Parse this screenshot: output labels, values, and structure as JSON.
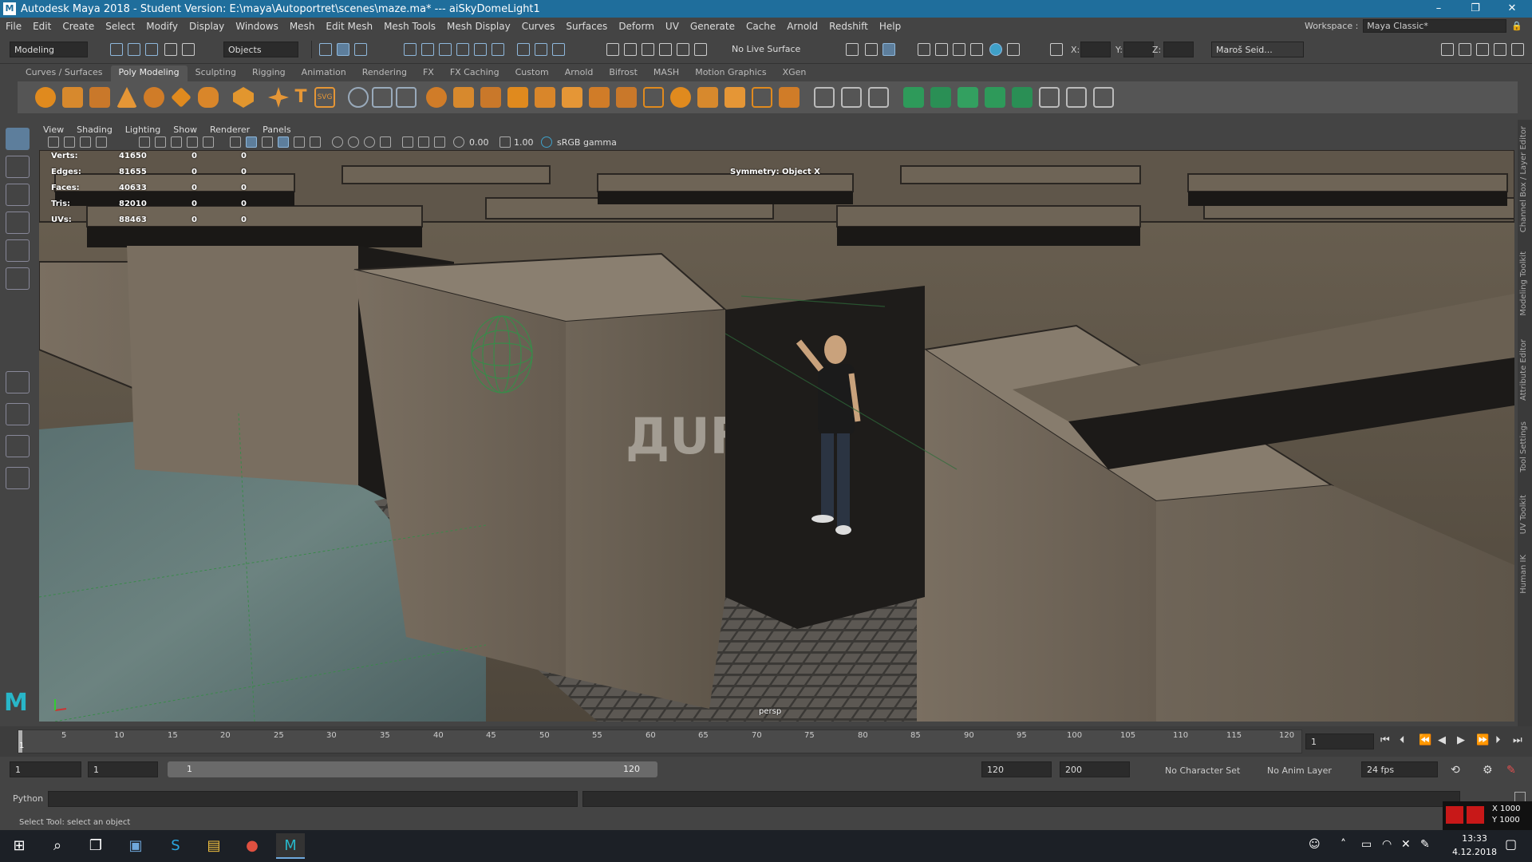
{
  "window": {
    "title": "Autodesk Maya 2018 - Student Version: E:\\maya\\Autoportret\\scenes\\maze.ma*  ---  aiSkyDomeLight1",
    "min": "–",
    "max": "❐",
    "close": "✕"
  },
  "menu": [
    "File",
    "Edit",
    "Create",
    "Select",
    "Modify",
    "Display",
    "Windows",
    "Mesh",
    "Edit Mesh",
    "Mesh Tools",
    "Mesh Display",
    "Curves",
    "Surfaces",
    "Deform",
    "UV",
    "Generate",
    "Cache",
    "Arnold",
    "Redshift",
    "Help"
  ],
  "workspace": {
    "label": "Workspace :",
    "value": "Maya Classic*"
  },
  "status": {
    "menuset": "Modeling",
    "objects": "Objects",
    "live_surface": "No Live Surface",
    "x": "X:",
    "y": "Y:",
    "z": "Z:",
    "user": "Maroš Seid..."
  },
  "shelf_tabs": [
    "Curves / Surfaces",
    "Poly Modeling",
    "Sculpting",
    "Rigging",
    "Animation",
    "Rendering",
    "FX",
    "FX Caching",
    "Custom",
    "Arnold",
    "Bifrost",
    "MASH",
    "Motion Graphics",
    "XGen"
  ],
  "active_shelf_tab": "Poly Modeling",
  "panel_menu": [
    "View",
    "Shading",
    "Lighting",
    "Show",
    "Renderer",
    "Panels"
  ],
  "panel_toolbar": {
    "exposure": "0.00",
    "gamma": "1.00",
    "colorspace": "sRGB gamma"
  },
  "hud": {
    "rows": [
      {
        "label": "Verts:",
        "a": "41650",
        "b": "0",
        "c": "0"
      },
      {
        "label": "Edges:",
        "a": "81655",
        "b": "0",
        "c": "0"
      },
      {
        "label": "Faces:",
        "a": "40633",
        "b": "0",
        "c": "0"
      },
      {
        "label": "Tris:",
        "a": "82010",
        "b": "0",
        "c": "0"
      },
      {
        "label": "UVs:",
        "a": "88463",
        "b": "0",
        "c": "0"
      }
    ],
    "symmetry": "Symmetry: Object X",
    "camera": "persp"
  },
  "right_strip": [
    "Channel Box / Layer Editor",
    "Modeling Toolkit",
    "Attribute Editor",
    "Tool Settings",
    "UV Toolkit",
    "Human IK"
  ],
  "timeline": {
    "ticks": [
      "5",
      "10",
      "15",
      "20",
      "25",
      "30",
      "35",
      "40",
      "45",
      "50",
      "55",
      "60",
      "65",
      "70",
      "75",
      "80",
      "85",
      "90",
      "95",
      "100",
      "105",
      "110",
      "115",
      "120"
    ],
    "start_mark": "1",
    "current_frame": "1"
  },
  "range": {
    "start": "1",
    "anim_start": "1",
    "range_start": "1",
    "range_end": "120",
    "playback_end": "120",
    "anim_end": "200",
    "char_set": "No Character Set",
    "anim_layer": "No Anim Layer",
    "fps": "24 fps"
  },
  "cmd": {
    "label": "Python"
  },
  "help": {
    "text": "Select Tool: select an object"
  },
  "coords": {
    "x": "X 1000",
    "y": "Y 1000"
  },
  "taskbar": {
    "time": "13:33",
    "date": "4.12.2018"
  }
}
